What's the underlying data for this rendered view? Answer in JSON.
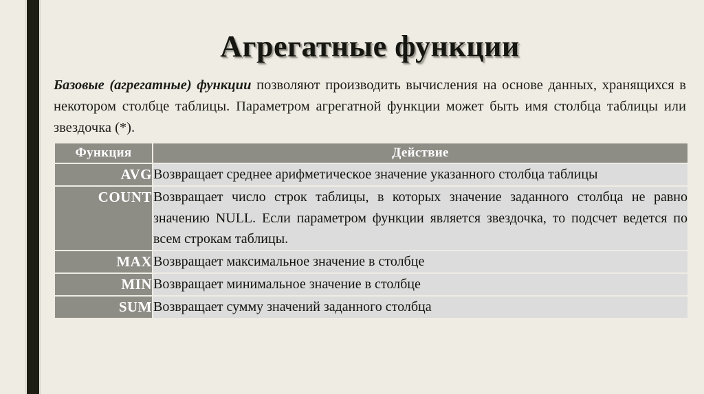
{
  "slide": {
    "title": "Агрегатные функции",
    "background_color": "#efece4",
    "accent_stripe_color": "#1e1e14",
    "header_fill_color": "#8d8d86",
    "body_fill_color": "#dcdcdc"
  },
  "paragraph": {
    "lead": "Базовые (агрегатные) функции",
    "rest": " позволяют производить вычисления на основе данных, хранящихся в некотором столбце таблицы. Параметром агрегатной функции может быть имя столбца таблицы или звездочка (*)."
  },
  "table": {
    "headers": [
      "Функция",
      "Действие"
    ],
    "rows": [
      {
        "function": "AVG",
        "action": "Возвращает среднее арифметическое значение указанного столбца таблицы"
      },
      {
        "function": "COUNT",
        "action": "Возвращает число строк таблицы, в которых значение заданного столбца не равно значению NULL. Если параметром функции является звездочка, то подсчет ведется по всем строкам таблицы."
      },
      {
        "function": "MAX",
        "action": "Возвращает максимальное значение в столбце"
      },
      {
        "function": "MIN",
        "action": "Возвращает минимальное значение в столбце"
      },
      {
        "function": "SUM",
        "action": "Возвращает сумму значений заданного столбца"
      }
    ]
  }
}
